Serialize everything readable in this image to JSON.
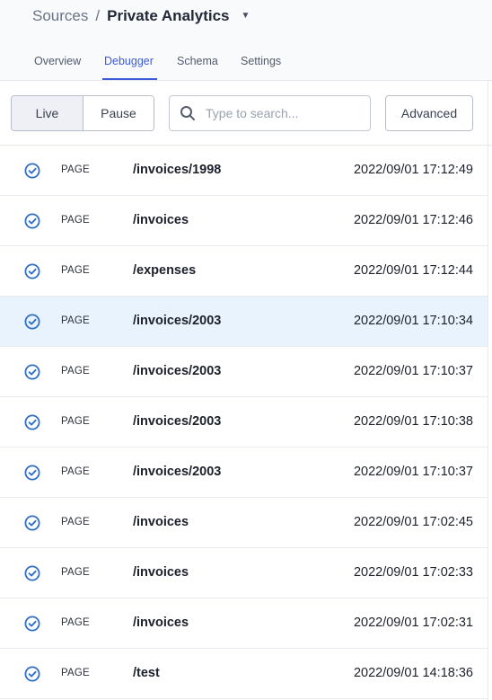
{
  "breadcrumb": {
    "source": "Sources",
    "separator": "/",
    "current": "Private Analytics"
  },
  "tabs": [
    {
      "label": "Overview",
      "active": false
    },
    {
      "label": "Debugger",
      "active": true
    },
    {
      "label": "Schema",
      "active": false
    },
    {
      "label": "Settings",
      "active": false
    }
  ],
  "toolbar": {
    "live_label": "Live",
    "pause_label": "Pause",
    "search_placeholder": "Type to search...",
    "advanced_label": "Advanced"
  },
  "events": [
    {
      "type": "PAGE",
      "path": "/invoices/1998",
      "time": "2022/09/01 17:12:49",
      "selected": false
    },
    {
      "type": "PAGE",
      "path": "/invoices",
      "time": "2022/09/01 17:12:46",
      "selected": false
    },
    {
      "type": "PAGE",
      "path": "/expenses",
      "time": "2022/09/01 17:12:44",
      "selected": false
    },
    {
      "type": "PAGE",
      "path": "/invoices/2003",
      "time": "2022/09/01 17:10:34",
      "selected": true
    },
    {
      "type": "PAGE",
      "path": "/invoices/2003",
      "time": "2022/09/01 17:10:37",
      "selected": false
    },
    {
      "type": "PAGE",
      "path": "/invoices/2003",
      "time": "2022/09/01 17:10:38",
      "selected": false
    },
    {
      "type": "PAGE",
      "path": "/invoices/2003",
      "time": "2022/09/01 17:10:37",
      "selected": false
    },
    {
      "type": "PAGE",
      "path": "/invoices",
      "time": "2022/09/01 17:02:45",
      "selected": false
    },
    {
      "type": "PAGE",
      "path": "/invoices",
      "time": "2022/09/01 17:02:33",
      "selected": false
    },
    {
      "type": "PAGE",
      "path": "/invoices",
      "time": "2022/09/01 17:02:31",
      "selected": false
    },
    {
      "type": "PAGE",
      "path": "/test",
      "time": "2022/09/01 14:18:36",
      "selected": false
    }
  ],
  "colors": {
    "accent": "#3d5bd8",
    "check_icon": "#2f6fc4",
    "selected_row": "#e9f3fd"
  },
  "icons": {
    "row_status": "check-circle-icon",
    "search": "search-icon",
    "source_menu": "caret-down-icon"
  }
}
